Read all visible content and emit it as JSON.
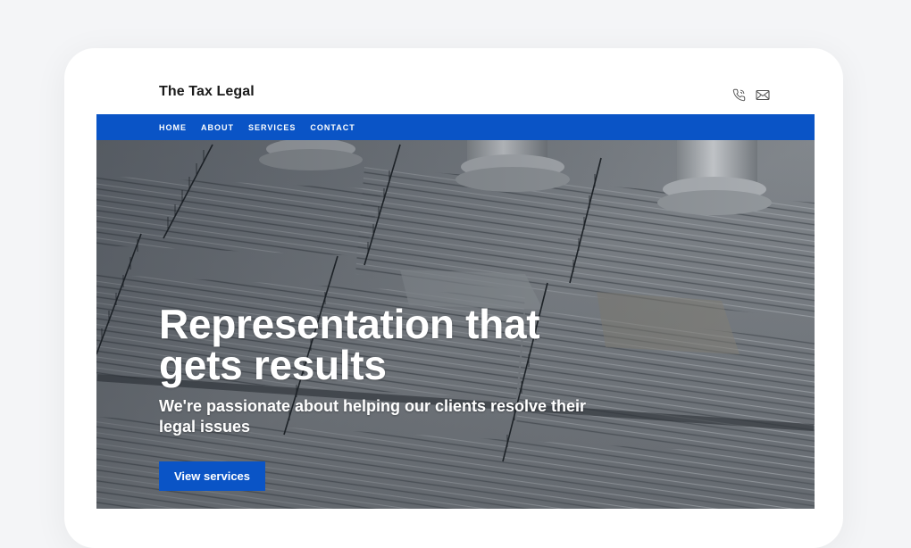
{
  "brand": {
    "name": "The Tax Legal"
  },
  "header": {
    "icons": [
      "phone-icon",
      "mail-icon"
    ]
  },
  "nav": {
    "items": [
      {
        "label": "HOME"
      },
      {
        "label": "ABOUT"
      },
      {
        "label": "SERVICES"
      },
      {
        "label": "CONTACT"
      }
    ]
  },
  "hero": {
    "title": "Representation that gets results",
    "subtitle": "We're passionate about helping our clients resolve their legal issues",
    "cta_label": "View services",
    "image": "courthouse-steps-photo"
  },
  "colors": {
    "accent": "#0a54c6",
    "text_dark": "#1a1a1a",
    "hero_text": "#ffffff"
  }
}
